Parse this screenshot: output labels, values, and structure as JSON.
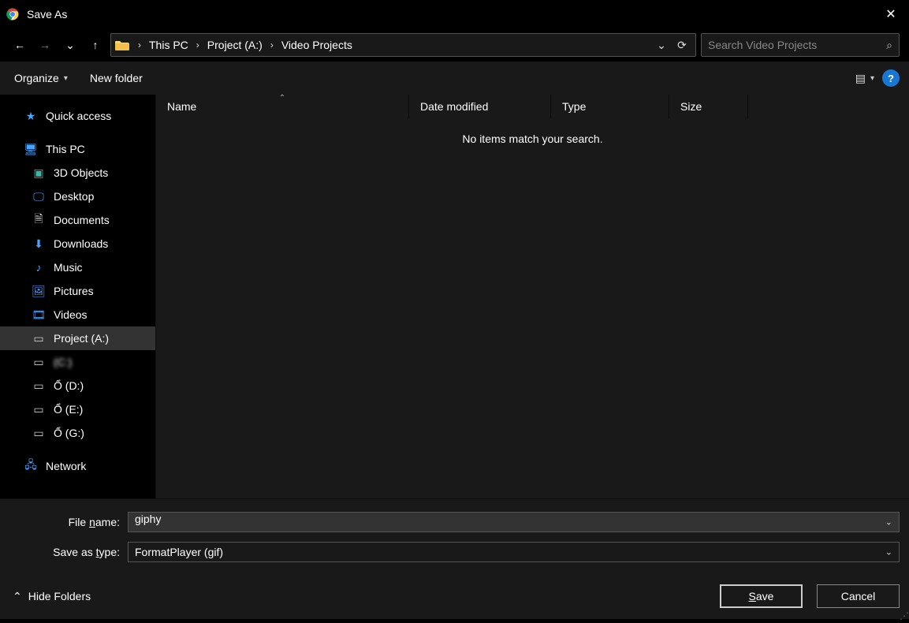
{
  "window": {
    "title": "Save As",
    "close_glyph": "✕"
  },
  "nav": {
    "back_glyph": "←",
    "fwd_glyph": "→",
    "recent_glyph": "⌄",
    "up_glyph": "↑",
    "refresh_glyph": "⟳",
    "history_glyph": "⌄"
  },
  "breadcrumb": {
    "parts": [
      "This PC",
      "Project (A:)",
      "Video Projects"
    ],
    "sep": "›"
  },
  "search": {
    "placeholder": "Search Video Projects",
    "mag_glyph": "⌕"
  },
  "toolbar": {
    "organize": "Organize",
    "new_folder": "New folder",
    "help_glyph": "?",
    "view_glyph": "▤"
  },
  "columns": {
    "name": "Name",
    "date": "Date modified",
    "type": "Type",
    "size": "Size",
    "sort_caret": "⌃"
  },
  "empty_msg": "No items match your search.",
  "sidebar": {
    "quick": "Quick access",
    "thispc": "This PC",
    "items": [
      "3D Objects",
      "Desktop",
      "Documents",
      "Downloads",
      "Music",
      "Pictures",
      "Videos",
      "Project (A:)",
      "            (C:)",
      "Ổ (D:)",
      "Ổ (E:)",
      "Ổ (G:)"
    ],
    "network": "Network"
  },
  "form": {
    "filename_label_pre": "File ",
    "filename_label_ul": "n",
    "filename_label_post": "ame:",
    "filename_value": "giphy",
    "savetype_label_pre": "Save as ",
    "savetype_label_ul": "t",
    "savetype_label_post": "ype:",
    "savetype_value": "FormatPlayer (gif)"
  },
  "actions": {
    "hide_folders_caret": "⌃",
    "hide_folders": "Hide Folders",
    "save_ul": "S",
    "save_rest": "ave",
    "cancel": "Cancel"
  }
}
